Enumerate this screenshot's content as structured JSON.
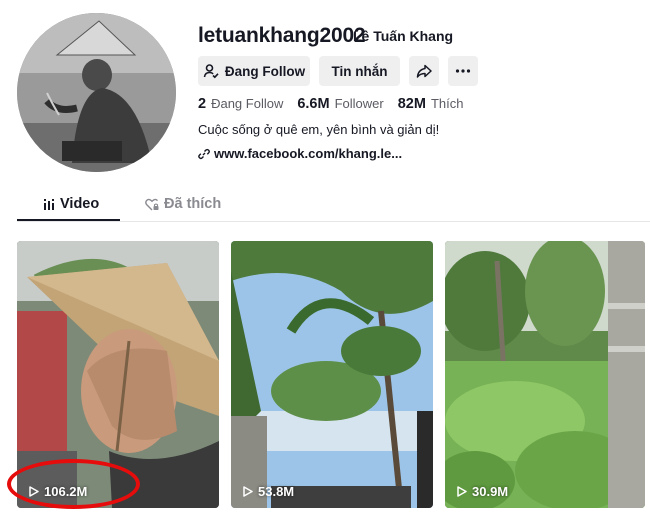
{
  "profile": {
    "username": "letuankhang2002",
    "nickname": "Lê Tuấn Khang",
    "bio": "Cuộc sống ở quê em, yên bình và giản dị!",
    "link": "www.facebook.com/khang.le..."
  },
  "actions": {
    "follow_label": "Đang Follow",
    "message_label": "Tin nhắn"
  },
  "stats": {
    "following_count": "2",
    "following_label": "Đang Follow",
    "followers_count": "6.6M",
    "followers_label": "Follower",
    "likes_count": "82M",
    "likes_label": "Thích"
  },
  "tabs": [
    {
      "label": "Video",
      "icon": "video-grid-icon",
      "active": true
    },
    {
      "label": "Đã thích",
      "icon": "heart-lock-icon",
      "active": false
    }
  ],
  "videos": [
    {
      "views": "106.2M"
    },
    {
      "views": "53.8M"
    },
    {
      "views": "30.9M"
    }
  ],
  "annotation": {
    "color": "#e60c0c"
  }
}
